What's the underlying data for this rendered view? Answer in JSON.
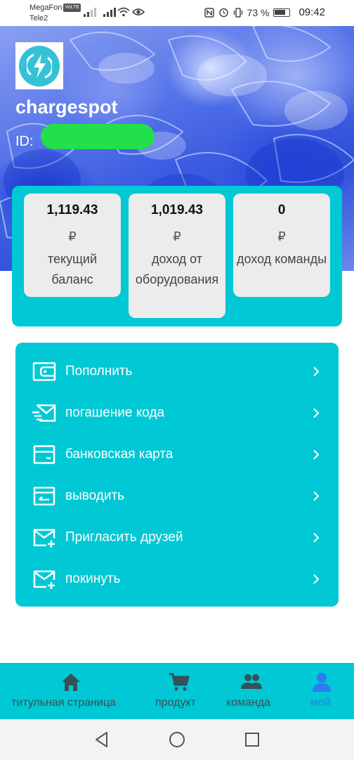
{
  "status_bar": {
    "carrier1": "MegaFon",
    "carrier1_badge": "VoLTE",
    "carrier2": "Tele2",
    "battery_percent": "73 %",
    "time": "09:42"
  },
  "header": {
    "brand": "chargespot",
    "id_label": "ID:"
  },
  "stats": [
    {
      "value": "1,119.43",
      "currency": "₽",
      "label": "текущий баланс"
    },
    {
      "value": "1,019.43",
      "currency": "₽",
      "label": "доход от оборудования"
    },
    {
      "value": "0",
      "currency": "₽",
      "label": "доход команды"
    }
  ],
  "menu": [
    {
      "label": "Пополнить",
      "icon": "wallet-icon"
    },
    {
      "label": "погашение кода",
      "icon": "envelope-fast-icon"
    },
    {
      "label": "банковская карта",
      "icon": "card-icon"
    },
    {
      "label": "выводить",
      "icon": "withdraw-icon"
    },
    {
      "label": "Пригласить друзей",
      "icon": "envelope-plus-icon"
    },
    {
      "label": "покинуть",
      "icon": "envelope-plus-icon"
    }
  ],
  "bottom_nav": [
    {
      "label": "титульная страница",
      "icon": "home-icon",
      "active": false
    },
    {
      "label": "продукт",
      "icon": "cart-icon",
      "active": false
    },
    {
      "label": "команда",
      "icon": "team-icon",
      "active": false
    },
    {
      "label": "мой",
      "icon": "user-icon",
      "active": true
    }
  ],
  "colors": {
    "accent": "#00c8d4",
    "active_tab": "#2f7bf2",
    "id_mask": "#22e04a"
  }
}
